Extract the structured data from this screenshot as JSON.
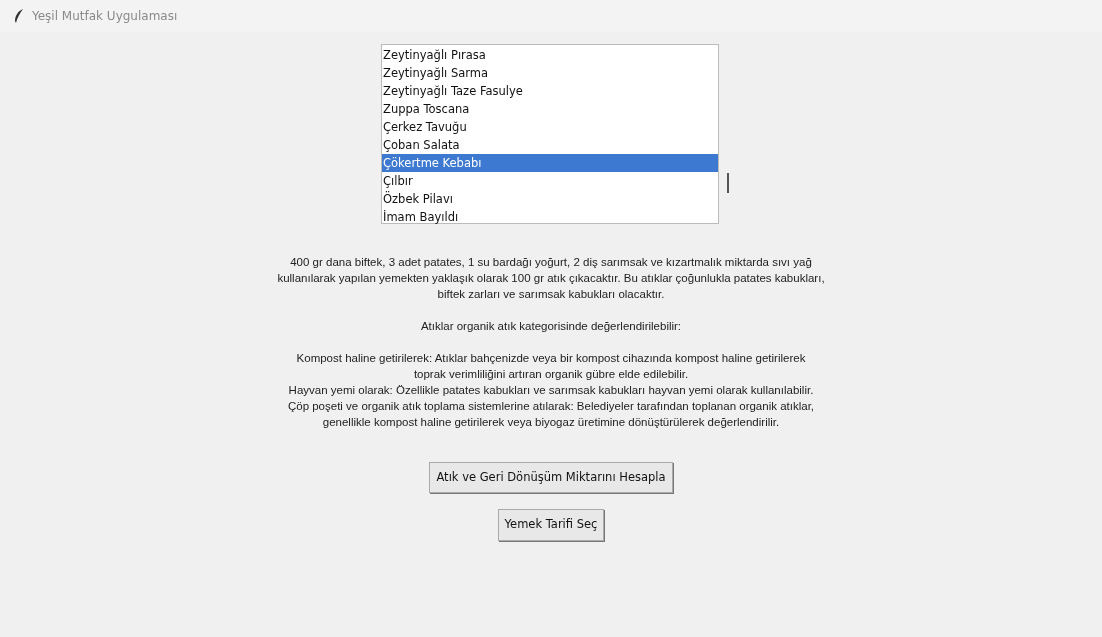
{
  "window": {
    "title": "Yeşil Mutfak Uygulaması"
  },
  "recipes": [
    {
      "label": "Zeytinyağlı Pırasa",
      "selected": false
    },
    {
      "label": "Zeytinyağlı Sarma",
      "selected": false
    },
    {
      "label": "Zeytinyağlı Taze Fasulye",
      "selected": false
    },
    {
      "label": "Zuppa Toscana",
      "selected": false
    },
    {
      "label": "Çerkez Tavuğu",
      "selected": false
    },
    {
      "label": "Çoban Salata",
      "selected": false
    },
    {
      "label": "Çökertme Kebabı",
      "selected": true
    },
    {
      "label": "Çılbır",
      "selected": false
    },
    {
      "label": "Özbek Pilavı",
      "selected": false
    },
    {
      "label": "İmam Bayıldı",
      "selected": false
    }
  ],
  "result": [
    "400 gr dana biftek, 3 adet patates, 1 su bardağı yoğurt, 2 diş sarımsak ve kızartmalık miktarda sıvı yağ\nkullanılarak yapılan yemekten yaklaşık olarak 100 gr atık çıkacaktır. Bu atıklar çoğunlukla patates kabukları,\nbiftek zarları ve sarımsak kabukları olacaktır.",
    "Atıklar organik atık kategorisinde değerlendirilebilir:",
    "Kompost haline getirilerek:   Atıklar bahçenizde veya bir kompost cihazında kompost haline getirilerek\ntoprak verimliliğini artıran organik gübre elde edilebilir.\nHayvan yemi olarak:   Özellikle patates kabukları ve sarımsak kabukları hayvan yemi olarak kullanılabilir.\nÇöp poşeti ve organik atık toplama sistemlerine atılarak:   Belediyeler tarafından toplanan organik atıklar,\ngenellikle kompost haline getirilerek veya biyogaz üretimine dönüştürülerek değerlendirilir."
  ],
  "buttons": [
    "Atık ve Geri Dönüşüm Miktarını Hesapla",
    "Yemek Tarifi Seç"
  ]
}
